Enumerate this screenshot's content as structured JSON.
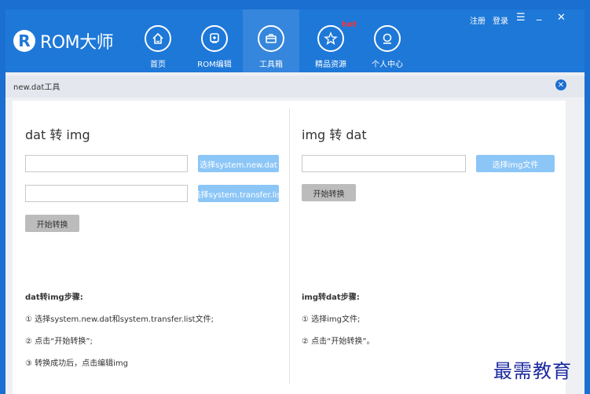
{
  "app": {
    "logo_glyph": "R",
    "logo_text": "ROM大师"
  },
  "nav": [
    {
      "label": "首页",
      "icon": "home-icon"
    },
    {
      "label": "ROM编辑",
      "icon": "rom-edit-icon"
    },
    {
      "label": "工具箱",
      "icon": "toolbox-icon"
    },
    {
      "label": "精品资源",
      "icon": "star-icon"
    },
    {
      "label": "个人中心",
      "icon": "user-icon"
    }
  ],
  "hot_badge": "hot",
  "window_controls": {
    "register": "注册",
    "login": "登录",
    "menu": "☰",
    "minimize": "_",
    "close": "✕"
  },
  "tool": {
    "title": "new.dat工具",
    "close_glyph": "✕"
  },
  "dat2img": {
    "title": "dat 转 img",
    "new_dat_value": "",
    "transfer_list_value": "",
    "btn_select_new_dat": "选择system.new.dat",
    "btn_select_transfer_list": "选择system.transfer.list",
    "btn_start": "开始转换",
    "steps_title": "dat转img步骤:",
    "steps": [
      "① 选择system.new.dat和system.transfer.list文件;",
      "② 点击“开始转换”;",
      "③ 转换成功后，点击编辑img"
    ]
  },
  "img2dat": {
    "title": "img 转 dat",
    "img_value": "",
    "btn_select_img": "选择img文件",
    "btn_start": "开始转换",
    "steps_title": "img转dat步骤:",
    "steps": [
      "① 选择img文件;",
      "② 点击“开始转换”。"
    ]
  },
  "watermark": "最需教育",
  "colors": {
    "header": "#1e78d8",
    "active_nav": "#3586dc",
    "button_blue": "#8cc6f7",
    "button_gray": "#bcbcbc",
    "hot": "#ff3030"
  }
}
